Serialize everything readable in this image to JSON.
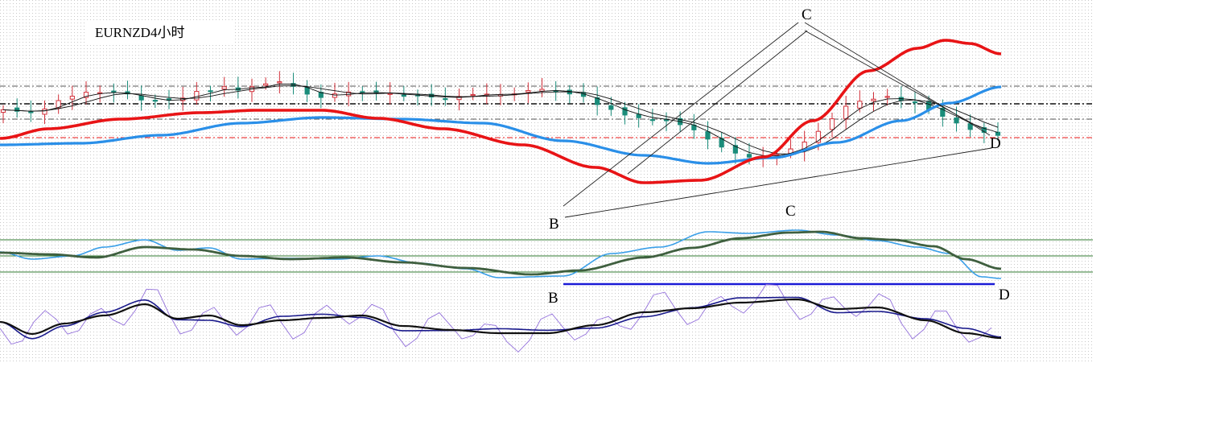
{
  "chart_data": [
    {
      "type": "candlestick",
      "title": "EURNZD4小时",
      "panel": "price",
      "grid": true,
      "pattern_labels": [
        "B",
        "C",
        "D"
      ],
      "candles": {
        "close": [
          50.6,
          49.9,
          49.3,
          51.0,
          55.0,
          57.1,
          59.0,
          58.8,
          58.9,
          58.2,
          55.3,
          55.0,
          55.1,
          56.2,
          59.4,
          59.7,
          61.6,
          60.0,
          61.6,
          63.0,
          64.0,
          61.8,
          58.1,
          56.5,
          58.2,
          59.1,
          58.8,
          58.7,
          58.4,
          57.1,
          57.5,
          56.7,
          55.9,
          57.0,
          57.9,
          58.1,
          57.9,
          58.2,
          59.8,
          60.4,
          59.5,
          58.2,
          57.0,
          53.1,
          50.8,
          48.1,
          46.8,
          45.9,
          45.5,
          43.5,
          41.0,
          36.6,
          32.8,
          29.9,
          28.0,
          28.3,
          29.3,
          31.9,
          35.2,
          40.3,
          46.3,
          52.3,
          54.7,
          55.7,
          57.0,
          55.1,
          54.0,
          50.8,
          47.5,
          44.3,
          41.2,
          39.8,
          38.4
        ]
      },
      "series": [
        {
          "name": "",
          "color": "#e81416",
          "line": "thick"
        },
        {
          "name": "",
          "color": "#2a8fe8",
          "line": "thick"
        },
        {
          "name": "",
          "color": "#111111",
          "line": "thin"
        }
      ],
      "levels_dashed": [
        "#555555",
        "#111111",
        "#555555",
        "#e81416"
      ]
    },
    {
      "type": "line",
      "panel": "oscillator-1",
      "pattern_labels": [
        "C",
        "B",
        "D"
      ],
      "reference_lines": 3,
      "series": [
        {
          "name": "",
          "color": "#3a9fe8"
        },
        {
          "name": "",
          "color": "#3f5f3f"
        }
      ],
      "trendline_color": "#1a1ad6"
    },
    {
      "type": "line",
      "panel": "oscillator-2",
      "series": [
        {
          "name": "",
          "color": "#9370db"
        },
        {
          "name": "",
          "color": "#1a1a8c"
        },
        {
          "name": "",
          "color": "#111111"
        }
      ]
    }
  ]
}
